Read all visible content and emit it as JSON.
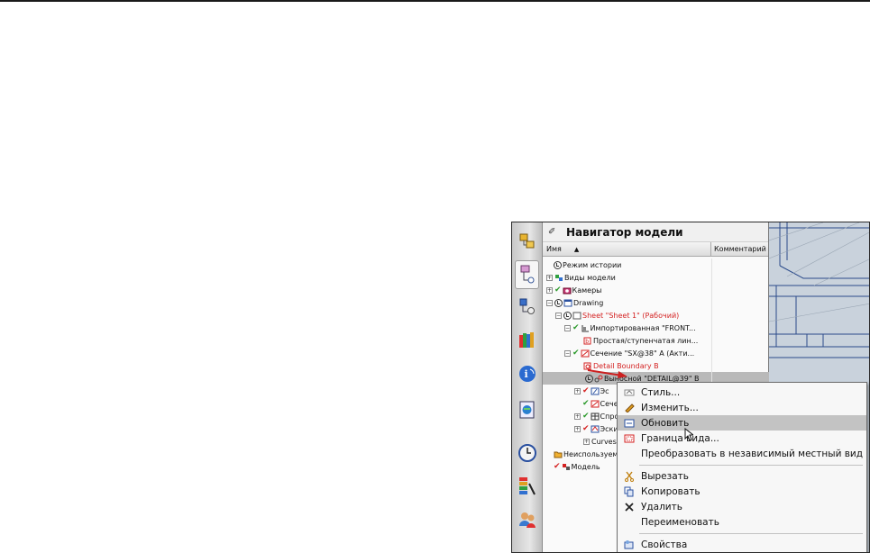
{
  "navigator": {
    "title": "Навигатор модели",
    "columns": {
      "name": "Имя",
      "comment": "Комментарий"
    },
    "rows": [
      {
        "label": "Режим истории"
      },
      {
        "label": "Виды модели"
      },
      {
        "label": "Камеры"
      },
      {
        "label": "Drawing"
      },
      {
        "label": "Sheet \"Sheet 1\" (Рабочий)"
      },
      {
        "label": "Импортированная \"FRONT..."
      },
      {
        "label": "Простая/ступенчатая лин..."
      },
      {
        "label": "Сечение \"SX@38\" А (Акти..."
      },
      {
        "label": "Detail Boundary B"
      },
      {
        "label": "Выносной \"DETAIL@39\" В"
      },
      {
        "label": "Эс"
      },
      {
        "label": "Сече"
      },
      {
        "label": "Спро"
      },
      {
        "label": "Эскиз"
      },
      {
        "label": "Curves"
      },
      {
        "label": "Неиспользуем"
      },
      {
        "label": "Модель"
      }
    ]
  },
  "context_menu": {
    "items": [
      {
        "label": "Стиль...",
        "icon": "style-icon"
      },
      {
        "label": "Изменить...",
        "icon": "edit-icon"
      },
      {
        "label": "Обновить",
        "icon": "update-icon"
      },
      {
        "label": "Граница вида...",
        "icon": "view-boundary-icon"
      },
      {
        "label": "Преобразовать в независимый местный вид",
        "icon": ""
      },
      {
        "label": "Вырезать",
        "icon": "cut-icon"
      },
      {
        "label": "Копировать",
        "icon": "copy-icon"
      },
      {
        "label": "Удалить",
        "icon": "delete-icon"
      },
      {
        "label": "Переименовать",
        "icon": ""
      },
      {
        "label": "Свойства",
        "icon": "properties-icon"
      }
    ],
    "highlighted": "Обновить"
  },
  "colors": {
    "highlight": "#c3c3c3",
    "selected_row": "#b9b9b9",
    "red_text": "#d42222",
    "arrow": "#cc2020"
  }
}
